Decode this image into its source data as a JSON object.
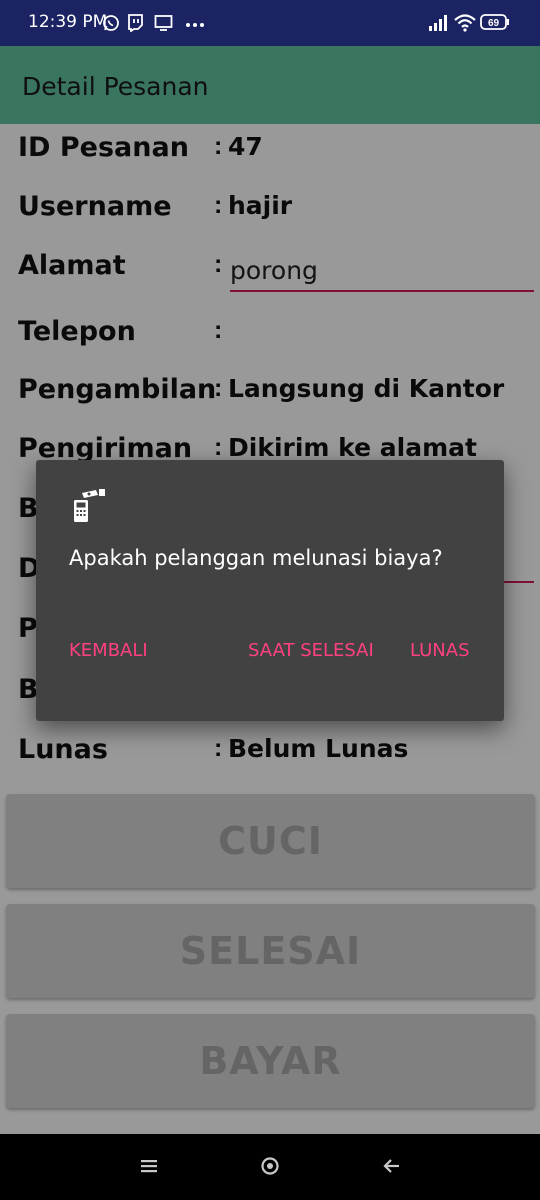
{
  "status_bar": {
    "time": "12:39 PM",
    "battery": "69",
    "icons": [
      "whatsapp-icon",
      "twitch-icon",
      "monitor-icon",
      "more-dots-icon",
      "signal-icon",
      "wifi-icon",
      "battery-icon"
    ]
  },
  "app_bar": {
    "title": "Detail Pesanan"
  },
  "details": {
    "rows": [
      {
        "label": "ID Pesanan",
        "value": "47"
      },
      {
        "label": "Username",
        "value": "hajir"
      },
      {
        "label": "Alamat",
        "value": "porong"
      },
      {
        "label": "Telepon",
        "value": ""
      },
      {
        "label": "Pengambilan",
        "value": "Langsung di Kantor"
      },
      {
        "label": "Pengiriman",
        "value": "Dikirim ke alamat"
      },
      {
        "label": "B",
        "value": ""
      },
      {
        "label": "D",
        "value": ""
      },
      {
        "label": "P",
        "value": ""
      },
      {
        "label": "B",
        "value": ""
      },
      {
        "label": "Lunas",
        "value": "Belum Lunas"
      }
    ],
    "colon": ":"
  },
  "buttons": {
    "cuci": "CUCI",
    "selesai": "SELESAI",
    "bayar": "BAYAR"
  },
  "dialog": {
    "icon": "cash-register-icon",
    "message": "Apakah pelanggan melunasi biaya?",
    "btn_back": "KEMBALI",
    "btn_later": "SAAT SELESAI",
    "btn_paid": "LUNAS",
    "accent_color": "#ff4081"
  },
  "colors": {
    "app_bar": "#62c3a1",
    "status_bar": "#1c2362",
    "field_underline": "#d81b60"
  },
  "nav_bar": {
    "icons": [
      "menu-icon",
      "home-icon",
      "back-icon"
    ]
  }
}
